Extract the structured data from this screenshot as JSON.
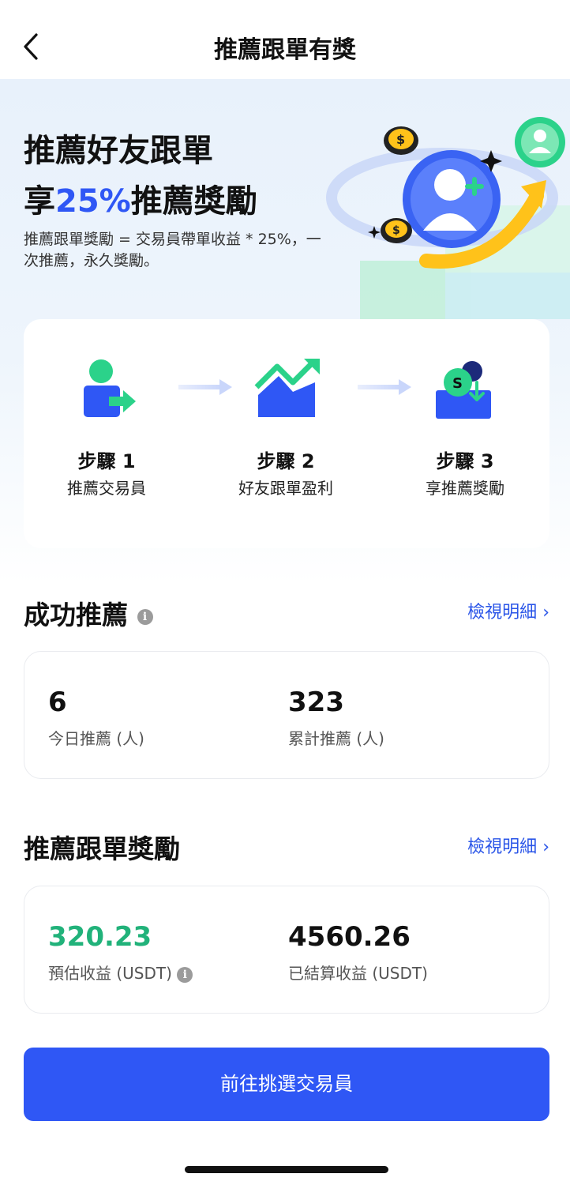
{
  "nav": {
    "title": "推薦跟單有獎"
  },
  "hero": {
    "title_line1": "推薦好友跟單",
    "title_line2_prefix": "享",
    "title_line2_highlight": "25%",
    "title_line2_suffix": "推薦獎勵",
    "description": "推薦跟單獎勵 = 交易員帶單收益 * 25%，一次推薦，永久獎勵。"
  },
  "steps": [
    {
      "title": "步驟 1",
      "subtitle": "推薦交易員",
      "icon": "refer-user-icon"
    },
    {
      "title": "步驟 2",
      "subtitle": "好友跟單盈利",
      "icon": "chart-up-icon"
    },
    {
      "title": "步驟 3",
      "subtitle": "享推薦獎勵",
      "icon": "reward-coin-icon"
    }
  ],
  "referrals": {
    "title": "成功推薦",
    "link": "檢視明細",
    "today_value": "6",
    "today_label": "今日推薦 (人)",
    "total_value": "323",
    "total_label": "累計推薦 (人)"
  },
  "rewards": {
    "title": "推薦跟單獎勵",
    "link": "檢視明細",
    "estimated_value": "320.23",
    "estimated_label": "預估收益 (USDT)",
    "settled_value": "4560.26",
    "settled_label": "已結算收益 (USDT)"
  },
  "cta": {
    "label": "前往挑選交易員"
  },
  "colors": {
    "primary": "#2f57f5",
    "link": "#2a55e8",
    "positive": "#21b27a",
    "accent_green": "#2bd28a"
  }
}
